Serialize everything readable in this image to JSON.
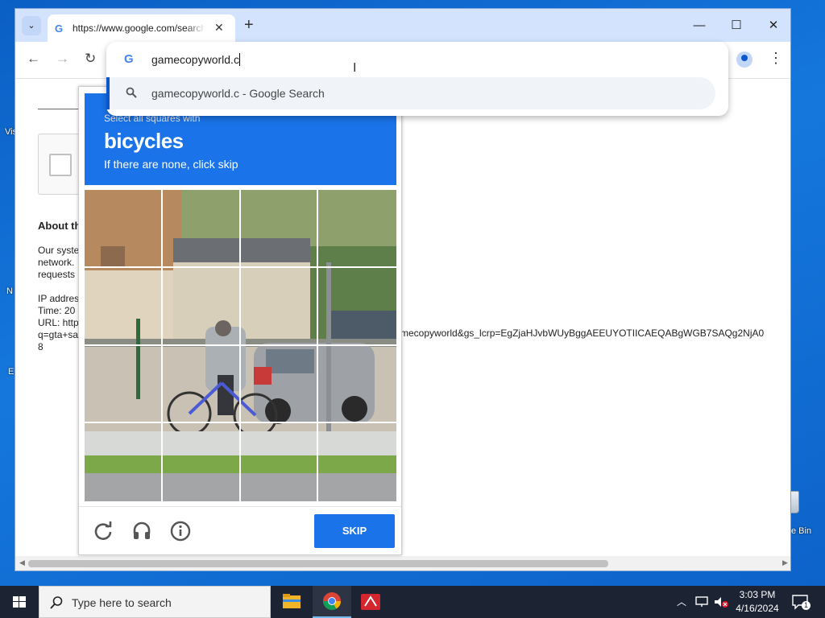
{
  "desktop": {
    "left_labels": [
      "Vis",
      "N",
      "E"
    ],
    "recycle_bin_label": "e Bin"
  },
  "browser": {
    "tab": {
      "title": "https://www.google.com/search",
      "icon": "google-g-icon"
    },
    "omnibox": {
      "query": "gamecopyworld.c",
      "suggestion": "gamecopyworld.c - Google Search"
    }
  },
  "page": {
    "about_heading": "About th",
    "lines": [
      "Our syste",
      "network.",
      "requests"
    ],
    "ip_line": "IP addres",
    "time_line": "Time: 20",
    "url_line": "URL: http",
    "q_line": "q=gta+sa",
    "num_line": "8",
    "url_tail": "mecopyworld&gs_lcrp=EgZjaHJvbWUyBggAEEUYOTIICAEQABgWGB7SAQg2NjA0"
  },
  "captcha": {
    "instruction_small": "Select all squares with",
    "target": "bicycles",
    "instruction_sub": "If there are none, click skip",
    "skip_label": "SKIP",
    "grid": {
      "rows": 4,
      "cols": 4
    },
    "colors": {
      "accent": "#1a73e8"
    }
  },
  "taskbar": {
    "search_placeholder": "Type here to search",
    "time": "3:03 PM",
    "date": "4/16/2024",
    "notification_count": "1"
  }
}
